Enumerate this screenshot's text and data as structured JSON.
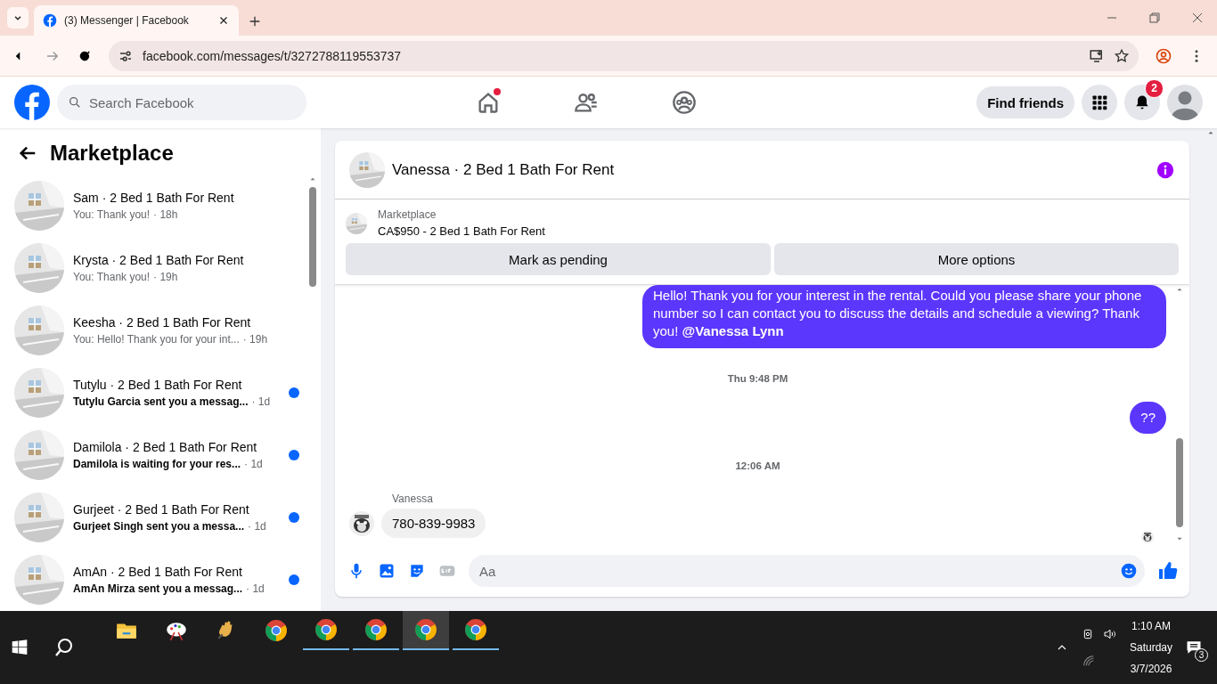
{
  "browser": {
    "tab_title": "(3) Messenger | Facebook",
    "url": "facebook.com/messages/t/3272788119553737"
  },
  "header": {
    "search_placeholder": "Search Facebook",
    "home_dot": true,
    "find_friends": "Find friends",
    "notification_count": "2"
  },
  "sidebar": {
    "title": "Marketplace",
    "conversations": [
      {
        "title": "Sam · 2 Bed 1 Bath For Rent",
        "preview": "You: Thank you!",
        "time": "· 18h",
        "unread": false
      },
      {
        "title": "Krysta · 2 Bed 1 Bath For Rent",
        "preview": "You: Thank you!",
        "time": "· 19h",
        "unread": false
      },
      {
        "title": "Keesha · 2 Bed 1 Bath For Rent",
        "preview": "You: Hello! Thank you for your int...",
        "time": "· 19h",
        "unread": false
      },
      {
        "title": "Tutylu · 2 Bed 1 Bath For Rent",
        "preview": "Tutylu Garcia sent you a messag...",
        "time": "· 1d",
        "unread": true
      },
      {
        "title": "Damilola · 2 Bed 1 Bath For Rent",
        "preview": "Damilola is waiting for your res...",
        "time": "· 1d",
        "unread": true
      },
      {
        "title": "Gurjeet · 2 Bed 1 Bath For Rent",
        "preview": "Gurjeet Singh sent you a messa...",
        "time": "· 1d",
        "unread": true
      },
      {
        "title": "AmAn · 2 Bed 1 Bath For Rent",
        "preview": "AmAn Mirza sent you a messag...",
        "time": "· 1d",
        "unread": true
      }
    ]
  },
  "chat": {
    "title": "Vanessa · 2 Bed 1 Bath For Rent",
    "listing": {
      "label": "Marketplace",
      "item": "CA$950 - 2 Bed 1 Bath For Rent"
    },
    "buttons": [
      "Mark as pending",
      "More options"
    ],
    "messages": [
      {
        "kind": "outgoing",
        "text": "Hello! Thank you for your interest in the rental. Could you please share your phone number so I can contact you to discuss the details and schedule a viewing? Thank you!  **@Vanessa Lynn**"
      },
      {
        "kind": "timestamp",
        "text": "Thu 9:48 PM"
      },
      {
        "kind": "outgoing",
        "text": "??"
      },
      {
        "kind": "timestamp",
        "text": "12:06 AM"
      },
      {
        "kind": "incoming",
        "sender": "Vanessa",
        "text": "780-839-9983"
      }
    ],
    "composer_placeholder": "Aa"
  },
  "taskbar": {
    "apps": [
      {
        "kind": "folder",
        "running": false,
        "selected": false
      },
      {
        "kind": "paint",
        "running": false,
        "selected": false
      },
      {
        "kind": "hand",
        "running": false,
        "selected": false
      },
      {
        "kind": "chrome",
        "running": false,
        "selected": false
      },
      {
        "kind": "chrome",
        "running": true,
        "selected": false
      },
      {
        "kind": "chrome",
        "running": true,
        "selected": false
      },
      {
        "kind": "chrome",
        "running": true,
        "selected": true
      },
      {
        "kind": "chrome",
        "running": true,
        "selected": false
      }
    ],
    "time": "1:10 AM",
    "day": "Saturday",
    "date": "3/7/2026",
    "notification_count": "3"
  }
}
